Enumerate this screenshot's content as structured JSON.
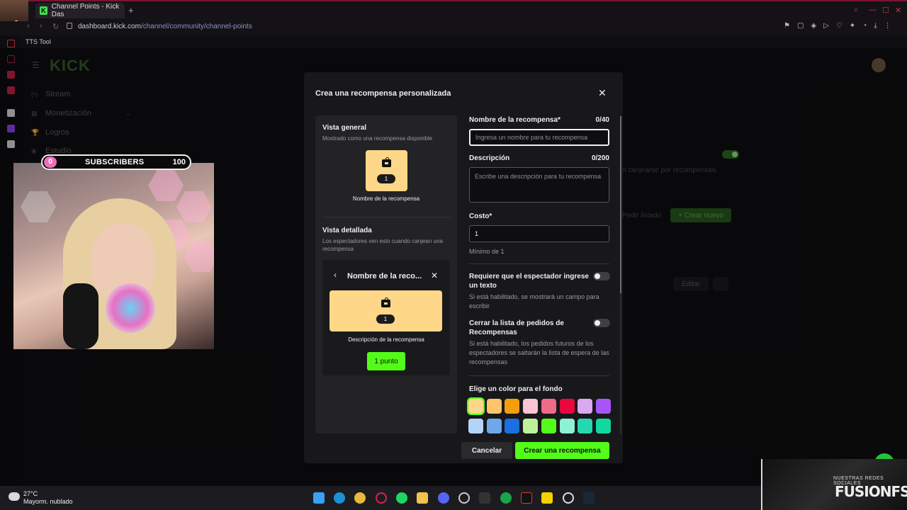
{
  "browser": {
    "tab_title": "Channel Points - Kick Das",
    "tab_favicon": "K",
    "new_tab": "+",
    "url_domain": "dashboard.kick.com",
    "url_path": "/channel/community/channel-points",
    "bookmark": "TTS Tool",
    "accent": "#53fc18"
  },
  "overlay": {
    "streamer_badge": "x6",
    "subs_current": "0",
    "subs_label": "SUBSCRIBERS",
    "subs_goal": "100"
  },
  "page": {
    "logo": "KICK",
    "nav": [
      {
        "label": "Stream",
        "icon": "(•)"
      },
      {
        "label": "Monetización",
        "icon": "▦"
      },
      {
        "label": "Logros",
        "icon": "🏆"
      },
      {
        "label": "Estudio",
        "icon": "◉"
      }
    ],
    "bg_hint": "n canjearse por recompensas.",
    "bg_request_list": "Pedir listado",
    "bg_create_new": "Crear nuevo",
    "bg_edit": "Editar"
  },
  "modal": {
    "title": "Crea una recompensa personalizada",
    "overview": {
      "heading": "Vista general",
      "subtitle": "Mostrado como una recompensa disponible",
      "cost_badge": "1",
      "card_caption": "Nombre de la recompensa"
    },
    "detailed": {
      "heading": "Vista detallada",
      "subtitle": "Los espectadores ven esto cuando canjean una recompensa",
      "title": "Nombre de la reco...",
      "cost_badge": "1",
      "description": "Descripción de la recompensa",
      "redeem_button": "1 punto"
    },
    "name": {
      "label": "Nombre de la recompensa*",
      "counter": "0/40",
      "placeholder": "Ingresa un nombre para tu recompensa",
      "value": ""
    },
    "description": {
      "label": "Descripción",
      "counter": "0/200",
      "placeholder": "Escribe una descripción para tu recompensa",
      "value": ""
    },
    "cost": {
      "label": "Costo*",
      "value": "1",
      "hint": "Mínimo de 1"
    },
    "require_text": {
      "label": "Requiere que el espectador ingrese un texto",
      "help": "Si está habilitado, se mostrará un campo para escribir",
      "enabled": false
    },
    "close_queue": {
      "label": "Cerrar la lista de pedidos de Recompensas",
      "help": "Si está habilitado, los pedidos futuros de los espectadores se saltarán la lista de espera de las recompensas",
      "enabled": false
    },
    "color": {
      "label": "Elige un color para el fondo",
      "swatches": [
        "#ffd789",
        "#ffc46b",
        "#f59e0b",
        "#fbc4d3",
        "#f06a8a",
        "#e8083e",
        "#dca8f0",
        "#a855f7",
        "#b4d4f5",
        "#6fa8e8",
        "#1b6fe0",
        "#bef29a",
        "#53fc18",
        "#8ef2d4",
        "#24d9b0",
        "#10d9a0"
      ],
      "selected_index": 0
    },
    "cancel": "Cancelar",
    "create": "Crear una recompensa"
  },
  "taskbar": {
    "temp": "27°C",
    "weather": "Mayorm. nublado"
  },
  "branding": {
    "small": "NUESTRAS REDES SOCIALES",
    "big": "FUSIONFSGG"
  }
}
